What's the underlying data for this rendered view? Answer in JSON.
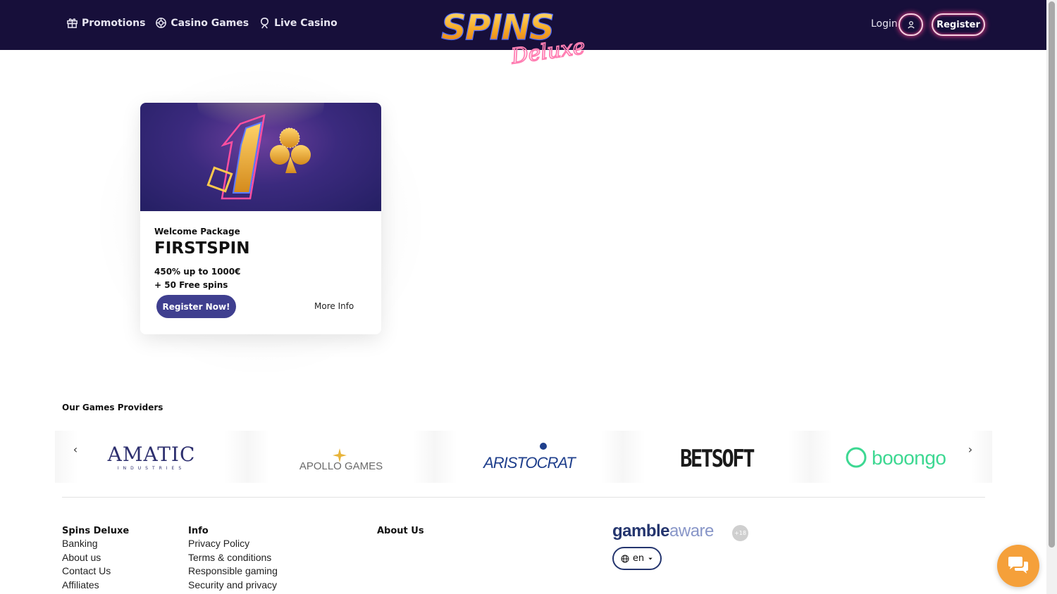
{
  "header": {
    "nav": [
      {
        "label": "Promotions",
        "icon": "gift-icon"
      },
      {
        "label": "Casino Games",
        "icon": "chip-icon"
      },
      {
        "label": "Live Casino",
        "icon": "dealer-icon"
      }
    ],
    "logo": {
      "main": "SPINS",
      "script": "Deluxe"
    },
    "login_label": "Login",
    "register_label": "Register"
  },
  "promo": {
    "subtitle": "Welcome Package",
    "title": "FIRSTSPIN",
    "line1": "450% up to 1000€",
    "line2": "+ 50 Free spins",
    "cta": "Register Now!",
    "more": "More Info"
  },
  "providers": {
    "title": "Our Games Providers",
    "prev_arrow": "‹",
    "next_arrow": "›",
    "items": [
      {
        "name": "AMATIC",
        "sub": "INDUSTRIES"
      },
      {
        "name": "APOLLO GAMES"
      },
      {
        "name": "ARISTOCRAT"
      },
      {
        "name": "BETSOFT"
      },
      {
        "name": "booongo"
      }
    ]
  },
  "footer": {
    "columns": [
      {
        "head": "Spins Deluxe",
        "links": [
          "Banking",
          "About us",
          "Contact Us",
          "Affiliates"
        ]
      },
      {
        "head": "Info",
        "links": [
          "Privacy Policy",
          "Terms & conditions",
          "Responsible gaming",
          "Security and privacy"
        ]
      },
      {
        "head": "About Us",
        "links": []
      }
    ],
    "gambleaware": {
      "part1": "gamble",
      "part2": "aware",
      "age": "+18"
    },
    "language": "en"
  },
  "colors": {
    "header_bg": "#170f3a",
    "accent_pink": "#ff3d8b",
    "cta_blue": "#3f3f8f",
    "chat_orange": "#f5a03a"
  }
}
